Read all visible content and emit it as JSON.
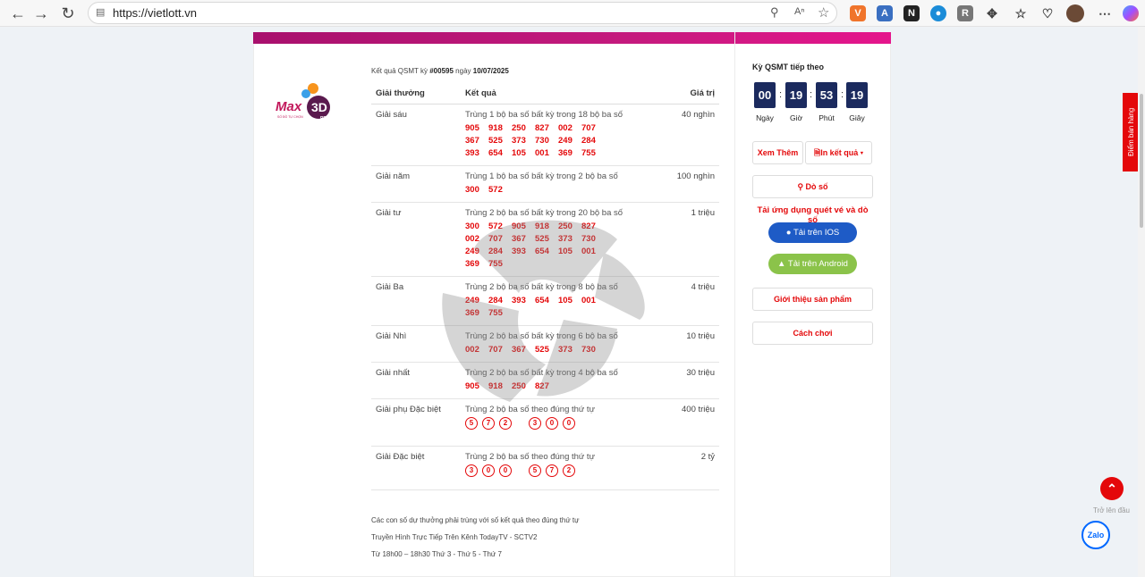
{
  "browser": {
    "url": "https://vietlott.vn",
    "extensions": [
      "V",
      "A",
      "N",
      "R",
      "R"
    ]
  },
  "header": {
    "prefix": "Kết quả QSMT kỳ",
    "draw_no": "#00595",
    "date_prefix": "ngày",
    "date": "10/07/2025"
  },
  "logo": {
    "text": "Max 3D PRO",
    "sub": "SỐ ĐỒ TỰ CHỌN"
  },
  "table": {
    "headers": [
      "Giải thưởng",
      "Kết quả",
      "Giá trị"
    ],
    "rows": [
      {
        "prize": "Giải sáu",
        "desc": "Trùng 1 bộ ba số bất kỳ trong 18 bộ ba số",
        "value": "40 nghìn",
        "numbers": [
          "905",
          "918",
          "250",
          "827",
          "002",
          "707",
          "367",
          "525",
          "373",
          "730",
          "249",
          "284",
          "393",
          "654",
          "105",
          "001",
          "369",
          "755"
        ]
      },
      {
        "prize": "Giải năm",
        "desc": "Trùng 1 bộ ba số bất kỳ trong 2 bộ ba số",
        "value": "100 nghìn",
        "numbers": [
          "300",
          "572"
        ]
      },
      {
        "prize": "Giải tư",
        "desc": "Trùng 2 bộ ba số bất kỳ trong 20 bộ ba số",
        "value": "1 triệu",
        "numbers": [
          "300",
          "572",
          "905",
          "918",
          "250",
          "827",
          "002",
          "707",
          "367",
          "525",
          "373",
          "730",
          "249",
          "284",
          "393",
          "654",
          "105",
          "001",
          "369",
          "755"
        ]
      },
      {
        "prize": "Giải Ba",
        "desc": "Trùng 2 bộ ba số bất kỳ trong 8 bộ ba số",
        "value": "4 triệu",
        "numbers": [
          "249",
          "284",
          "393",
          "654",
          "105",
          "001",
          "369",
          "755"
        ]
      },
      {
        "prize": "Giải Nhì",
        "desc": "Trùng 2 bộ ba số bất kỳ trong 6 bộ ba số",
        "value": "10 triệu",
        "numbers": [
          "002",
          "707",
          "367",
          "525",
          "373",
          "730"
        ]
      },
      {
        "prize": "Giải nhất",
        "desc": "Trùng 2 bộ ba số bất kỳ trong 4 bộ ba số",
        "value": "30 triệu",
        "numbers": [
          "905",
          "918",
          "250",
          "827"
        ]
      },
      {
        "prize": "Giải phụ Đặc biệt",
        "desc": "Trùng 2 bộ ba số theo đúng thứ tự",
        "value": "400 triệu",
        "balls": [
          [
            "5",
            "7",
            "2"
          ],
          [
            "3",
            "0",
            "0"
          ]
        ]
      },
      {
        "prize": "Giải Đặc biệt",
        "desc": "Trùng 2 bộ ba số theo đúng thứ tự",
        "value": "2 tỷ",
        "balls": [
          [
            "3",
            "0",
            "0"
          ],
          [
            "5",
            "7",
            "2"
          ]
        ]
      }
    ]
  },
  "notes": [
    "Các con số dự thưởng phải trùng với số kết quả theo đúng thứ tự",
    "Truyền Hình Trực Tiếp Trên Kênh TodayTV - SCTV2",
    "Từ 18h00 – 18h30 Thứ 3 - Thứ 5 - Thứ 7"
  ],
  "sidebar": {
    "title": "Kỳ QSMT tiếp theo",
    "countdown": [
      {
        "value": "00",
        "label": "Ngày"
      },
      {
        "value": "19",
        "label": "Giờ"
      },
      {
        "value": "53",
        "label": "Phút"
      },
      {
        "value": "19",
        "label": "Giây"
      }
    ],
    "more_label": "Xem Thêm",
    "print_label": "In kết quả",
    "check_label": "Dò số",
    "promo": "Tải ứng dụng quét vé và dò số",
    "ios_label": "Tải trên IOS",
    "android_label": "Tải trên Android",
    "intro_label": "Giới thiệu sản phẩm",
    "howto_label": "Cách chơi"
  },
  "floating": {
    "store_tab": "Điểm bán hàng",
    "totop_label": "Trở lên đầu",
    "zalo": "Zalo"
  },
  "colors": {
    "accent": "#e4080a",
    "countdown_bg": "#1b2a5e",
    "ios": "#1e5bc6",
    "android": "#8bc34a"
  }
}
